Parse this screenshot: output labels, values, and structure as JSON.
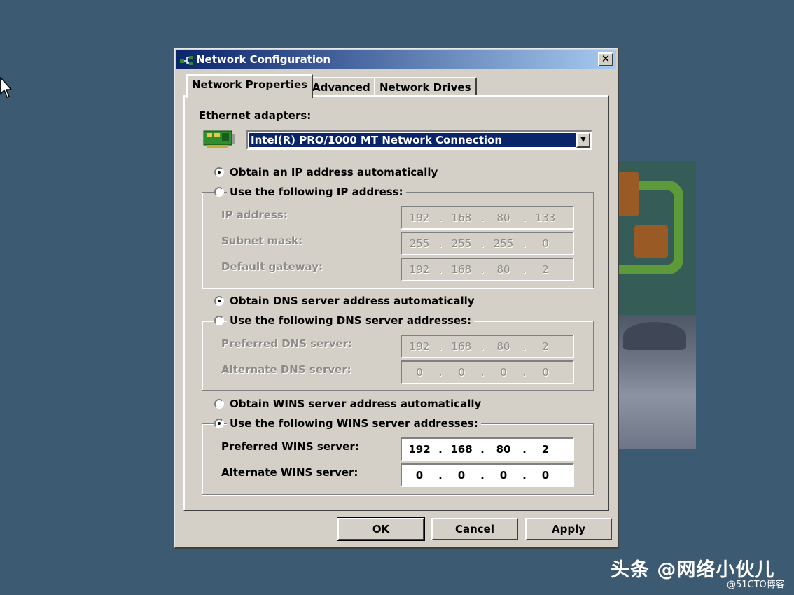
{
  "window": {
    "title": "Network Configuration",
    "close_glyph": "✕"
  },
  "tabs": [
    {
      "label": "Network Properties",
      "active": true
    },
    {
      "label": "Advanced",
      "active": false
    },
    {
      "label": "Network Drives",
      "active": false
    }
  ],
  "adapters": {
    "label": "Ethernet adapters:",
    "selected": "Intel(R) PRO/1000 MT Network Connection",
    "icon": "network-card-icon"
  },
  "ip": {
    "auto_label": "Obtain an IP address automatically",
    "auto_checked": true,
    "manual_label": "Use the following IP address:",
    "manual_checked": false,
    "fields": [
      {
        "label": "IP address:",
        "octets": [
          "192",
          "168",
          "80",
          "133"
        ],
        "enabled": false
      },
      {
        "label": "Subnet mask:",
        "octets": [
          "255",
          "255",
          "255",
          "0"
        ],
        "enabled": false
      },
      {
        "label": "Default gateway:",
        "octets": [
          "192",
          "168",
          "80",
          "2"
        ],
        "enabled": false
      }
    ]
  },
  "dns": {
    "auto_label": "Obtain DNS server address automatically",
    "auto_checked": true,
    "manual_label": "Use the following DNS server addresses:",
    "manual_checked": false,
    "fields": [
      {
        "label": "Preferred DNS server:",
        "octets": [
          "192",
          "168",
          "80",
          "2"
        ],
        "enabled": false
      },
      {
        "label": "Alternate DNS server:",
        "octets": [
          "0",
          "0",
          "0",
          "0"
        ],
        "enabled": false
      }
    ]
  },
  "wins": {
    "auto_label": "Obtain WINS server address automatically",
    "auto_checked": false,
    "manual_label": "Use the following WINS server addresses:",
    "manual_checked": true,
    "fields": [
      {
        "label": "Preferred WINS server:",
        "octets": [
          "192",
          "168",
          "80",
          "2"
        ],
        "enabled": true
      },
      {
        "label": "Alternate WINS server:",
        "octets": [
          "0",
          "0",
          "0",
          "0"
        ],
        "enabled": true
      }
    ]
  },
  "buttons": {
    "ok": "OK",
    "cancel": "Cancel",
    "apply": "Apply"
  },
  "watermark": {
    "main": "头条 @网络小伙儿",
    "sub": "@51CTO博客"
  },
  "colors": {
    "desktop": "#3d5a73",
    "titlebar": "#0a246a",
    "face": "#d4d0c8"
  }
}
